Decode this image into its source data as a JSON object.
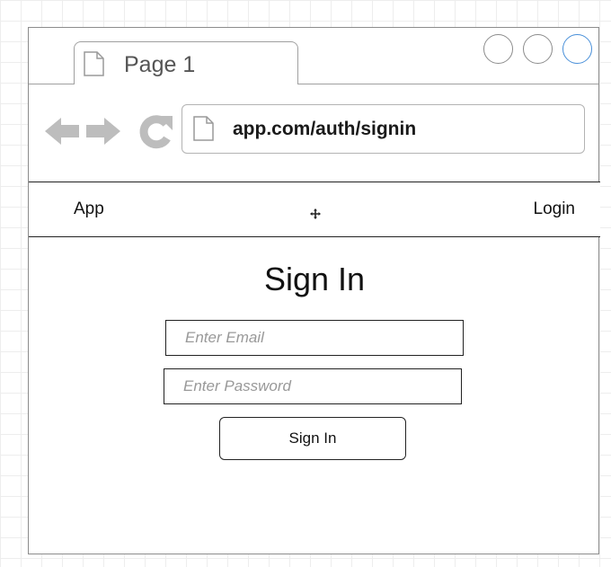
{
  "browser": {
    "tab": {
      "label": "Page 1",
      "icon": "document-icon"
    },
    "window_buttons": [
      "minimize",
      "maximize",
      "close"
    ],
    "nav": {
      "back_icon": "back-arrow-icon",
      "forward_icon": "forward-arrow-icon",
      "reload_icon": "reload-icon"
    },
    "address": {
      "url": "app.com/auth/signin",
      "icon": "document-icon"
    }
  },
  "navbar": {
    "brand": "App",
    "login": "Login"
  },
  "signin": {
    "title": "Sign In",
    "email_placeholder": "Enter Email",
    "password_placeholder": "Enter Password",
    "submit_label": "Sign In"
  },
  "colors": {
    "frame": "#8c8c8c",
    "close_button_accent": "#4a90d9",
    "nav_icon": "#bdbdbd",
    "placeholder": "#999999"
  }
}
